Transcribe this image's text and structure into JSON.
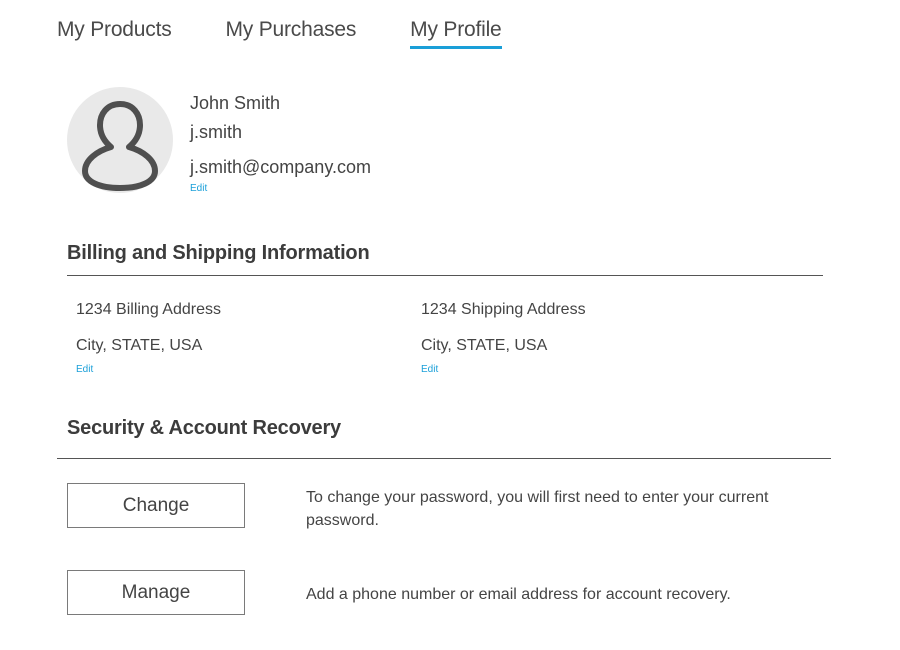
{
  "tabs": [
    {
      "label": "My Products",
      "active": false
    },
    {
      "label": "My Purchases",
      "active": false
    },
    {
      "label": "My Profile",
      "active": true
    }
  ],
  "profile": {
    "avatar_icon": "user-silhouette-icon",
    "name": "John Smith",
    "username": "j.smith",
    "email": "j.smith@company.com",
    "edit_label": "Edit"
  },
  "billing_section": {
    "title": "Billing and Shipping Information",
    "billing": {
      "line1": "1234 Billing Address",
      "line2": "City, STATE, USA",
      "edit_label": "Edit"
    },
    "shipping": {
      "line1": "1234 Shipping Address",
      "line2": "City, STATE, USA",
      "edit_label": "Edit"
    }
  },
  "security_section": {
    "title": "Security & Account Recovery",
    "password": {
      "button_label": "Change",
      "description": "To change your password, you will first need to enter your current password."
    },
    "recovery": {
      "button_label": "Manage",
      "description": "Add a phone number or email address for account recovery."
    }
  },
  "colors": {
    "accent": "#1a9fd8",
    "text": "#444444",
    "avatar_bg": "#e9e9e9"
  }
}
